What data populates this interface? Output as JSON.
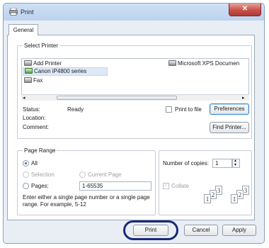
{
  "window": {
    "title": "Print",
    "close_glyph": "✕"
  },
  "tabs": [
    {
      "label": "General"
    }
  ],
  "select_printer": {
    "label": "Select Printer",
    "printers_left": [
      "Add Printer",
      "Canon iP4800 series",
      "Fax"
    ],
    "printers_right": [
      "Microsoft XPS Documen"
    ],
    "selected": "Canon iP4800 series"
  },
  "status": {
    "status_label": "Status:",
    "status_value": "Ready",
    "location_label": "Location:",
    "comment_label": "Comment:",
    "print_to_file_label": "Print to file",
    "preferences_button": "Preferences",
    "find_printer_button": "Find Printer..."
  },
  "page_range": {
    "label": "Page Range",
    "all": "All",
    "selection": "Selection",
    "current_page": "Current Page",
    "pages": "Pages:",
    "pages_value": "1-65535",
    "hint": "Enter either a single page number or a single page range.  For example, 5-12"
  },
  "copies": {
    "label": "Number of copies:",
    "value": "1",
    "collate_label": "Collate",
    "stack_a": [
      "1",
      "2",
      "3"
    ],
    "stack_b": [
      "1",
      "2",
      "3"
    ]
  },
  "buttons": {
    "print": "Print",
    "cancel": "Cancel",
    "apply": "Apply"
  },
  "icons": [
    "printer-icon",
    "check-printer-icon",
    "fax-icon",
    "close-icon",
    "spin-up-icon",
    "spin-down-icon"
  ]
}
